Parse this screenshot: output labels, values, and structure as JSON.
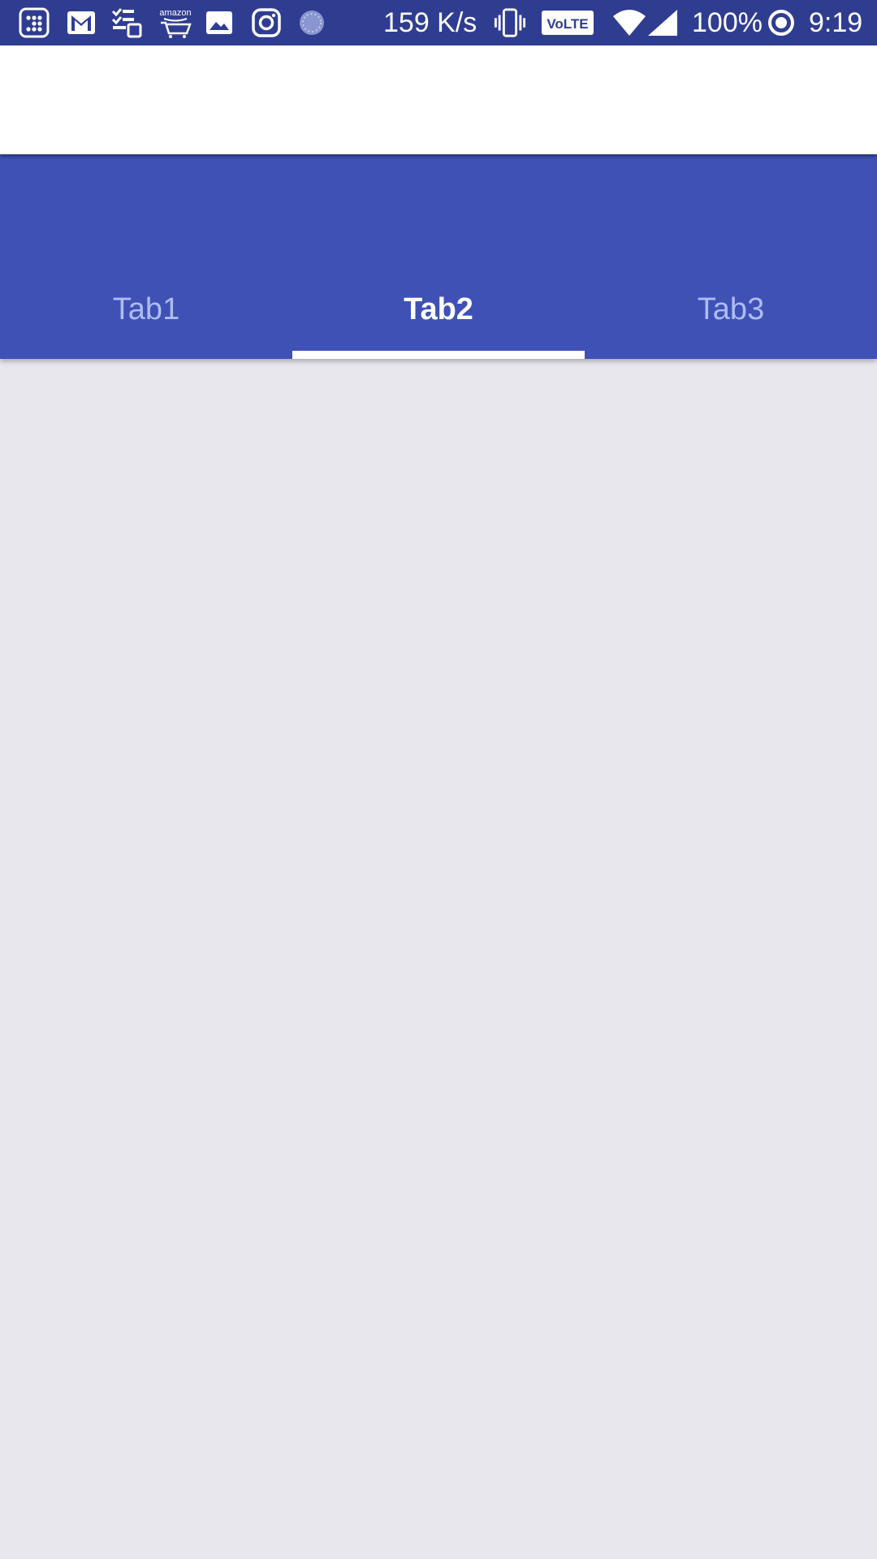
{
  "status_bar": {
    "network_speed": "159 K/s",
    "volte_label": "VoLTE",
    "battery": "100%",
    "time": "9:19",
    "notification_icons": [
      "apps-icon",
      "gmail-icon",
      "tasks-icon",
      "amazon-icon",
      "gallery-icon",
      "instagram-icon",
      "sync-icon"
    ],
    "system_icons": [
      "vibrate-icon",
      "volte-icon",
      "wifi-icon",
      "signal-icon",
      "battery-icon"
    ],
    "amazon_label": "amazon"
  },
  "tabs": [
    {
      "label": "Tab1",
      "selected": false
    },
    {
      "label": "Tab2",
      "selected": true
    },
    {
      "label": "Tab3",
      "selected": false
    }
  ],
  "colors": {
    "status_bar": "#2f3d91",
    "primary": "#3f51b5",
    "inactive_tab_text": "#aebcf3",
    "active_tab_text": "#ffffff",
    "background": "#e8e7ee"
  }
}
